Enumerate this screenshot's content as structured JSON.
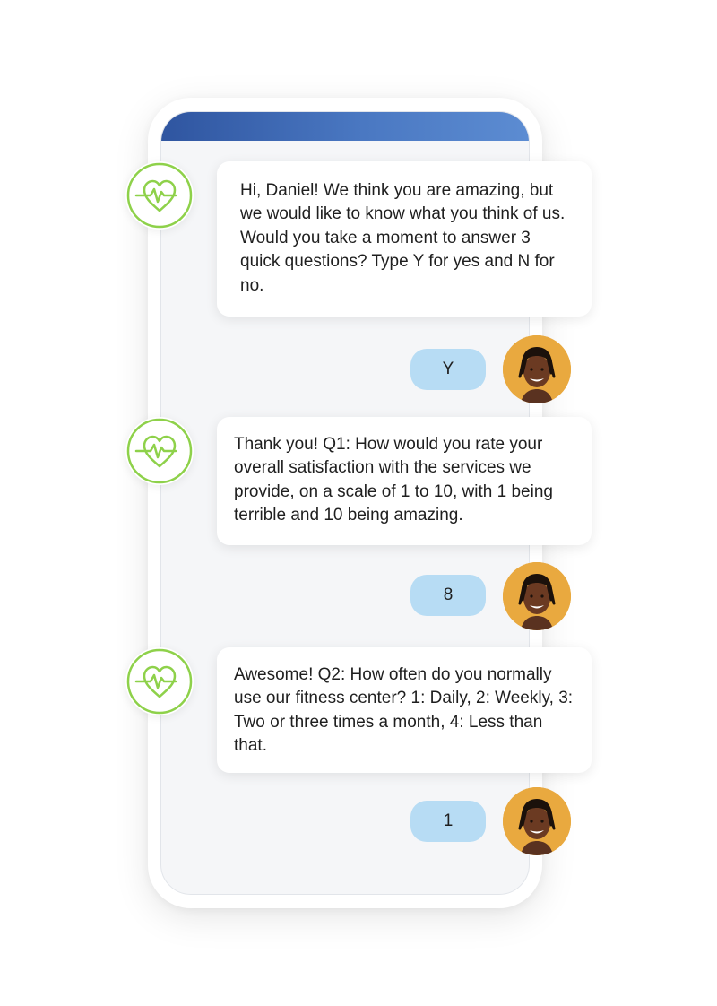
{
  "conversation": {
    "messages": [
      {
        "sender": "bot",
        "icon": "heart-pulse-icon",
        "text": "Hi, Daniel! We think you are amazing, but we would like to know what you think of us. Would you take a moment to answer 3 quick questions? Type Y for yes and N for no."
      },
      {
        "sender": "user",
        "avatar": "user-avatar",
        "text": "Y"
      },
      {
        "sender": "bot",
        "icon": "heart-pulse-icon",
        "text": "Thank you! Q1: How would you rate your overall satisfaction with the services we provide, on a scale of 1 to 10, with 1 being terrible and 10 being amazing."
      },
      {
        "sender": "user",
        "avatar": "user-avatar",
        "text": "8"
      },
      {
        "sender": "bot",
        "icon": "heart-pulse-icon",
        "text": "Awesome! Q2: How often do you normally use our fitness center? 1: Daily, 2: Weekly, 3: Two or three times a month, 4: Less than that."
      },
      {
        "sender": "user",
        "avatar": "user-avatar",
        "text": "1"
      }
    ]
  },
  "colors": {
    "header_gradient_start": "#2f55a0",
    "header_gradient_end": "#5c8cd2",
    "bot_icon_green": "#8ed14a",
    "user_bubble": "#b7dcf4",
    "avatar_background": "#e9a93f"
  }
}
